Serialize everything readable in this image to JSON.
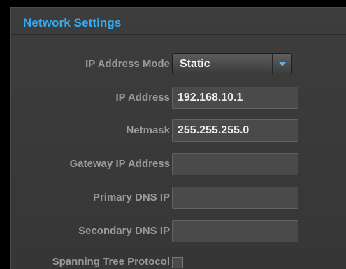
{
  "panel": {
    "title": "Network Settings"
  },
  "fields": {
    "ip_mode": {
      "label": "IP Address Mode",
      "value": "Static"
    },
    "ip_address": {
      "label": "IP Address",
      "value": "192.168.10.1"
    },
    "netmask": {
      "label": "Netmask",
      "value": "255.255.255.0"
    },
    "gateway": {
      "label": "Gateway IP Address",
      "value": ""
    },
    "primary_dns": {
      "label": "Primary DNS IP",
      "value": ""
    },
    "secondary_dns": {
      "label": "Secondary DNS IP",
      "value": ""
    },
    "spanning_tree": {
      "label": "Spanning Tree Protocol",
      "checked": false
    }
  },
  "icons": {
    "select_arrow": "chevron-down-icon"
  },
  "colors": {
    "title_accent": "#33aaf2",
    "arrow_accent": "#5ab4f0",
    "panel_bg": "#3a3a3a"
  }
}
